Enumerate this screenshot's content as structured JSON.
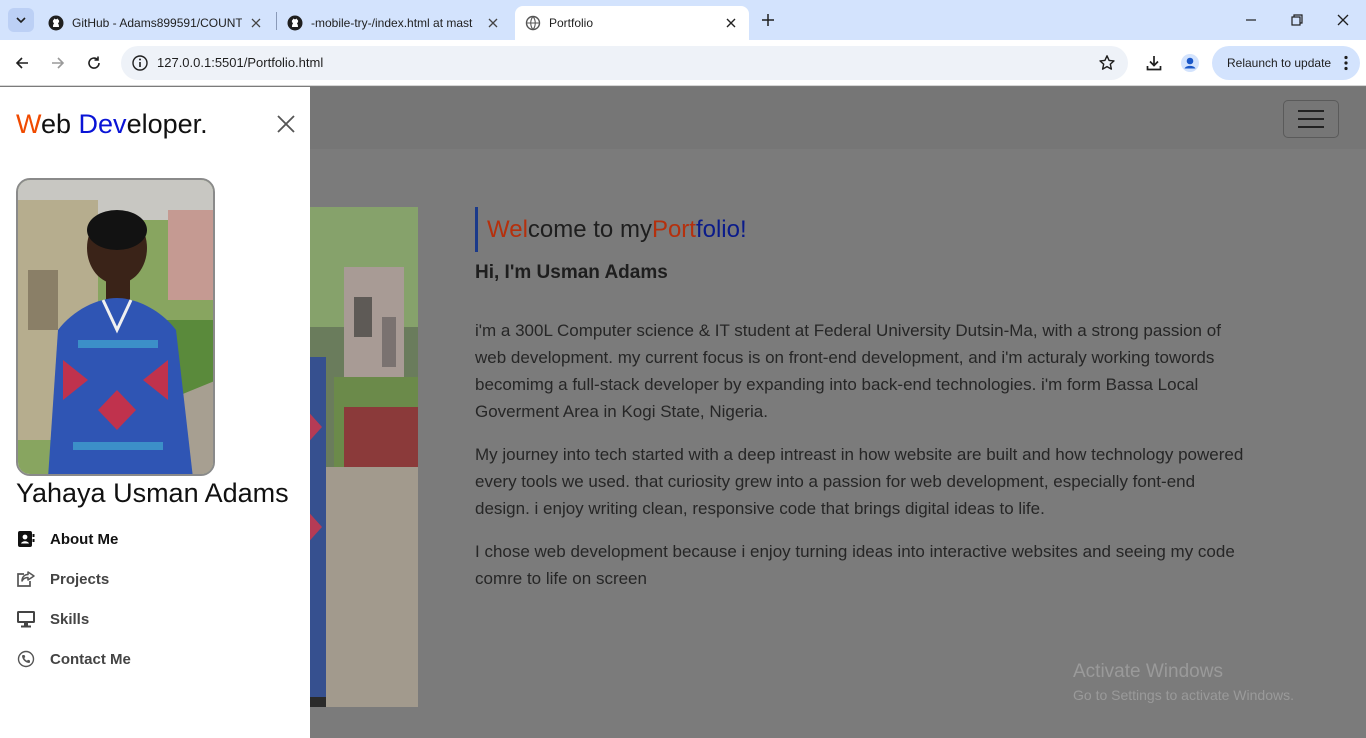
{
  "browser": {
    "tabs": [
      {
        "title": "GitHub - Adams899591/COUNT"
      },
      {
        "title": "-mobile-try-/index.html at mast"
      },
      {
        "title": "Portfolio"
      }
    ],
    "url": "127.0.0.1:5501/Portfolio.html",
    "relaunch_label": "Relaunch to update"
  },
  "sidebar": {
    "brand": {
      "p1": "W",
      "p2": "eb ",
      "p3": "Dev",
      "p4": "eloper."
    },
    "name": "Yahaya Usman Adams",
    "menu": [
      {
        "label": "About Me",
        "icon": "contact-card-icon"
      },
      {
        "label": "Projects",
        "icon": "share-icon"
      },
      {
        "label": "Skills",
        "icon": "desktop-icon"
      },
      {
        "label": "Contact Me",
        "icon": "phone-icon"
      }
    ]
  },
  "main": {
    "heading": {
      "p1": "Wel",
      "p2": "come to my ",
      "p3": "Port",
      "p4": "folio!"
    },
    "greeting": "Hi, I'm Usman Adams",
    "paragraphs": [
      "i'm a 300L Computer science & IT student at Federal University Dutsin-Ma, with a strong passion of web development. my current focus is on front-end development, and i'm acturaly working towords becomimg a full-stack developer by expanding into back-end technologies. i'm form Bassa Local Goverment Area in Kogi State, Nigeria.",
      "My journey into tech started with a deep intreast in how website are built and how technology powered every tools we used. that curiosity grew into a passion for web development, especially font-end design. i enjoy writing clean, responsive code that brings digital ideas to life.",
      "I chose web development because i enjoy turning ideas into interactive websites and seeing my code comre to life on screen"
    ]
  },
  "watermark": {
    "line1": "Activate Windows",
    "line2": "Go to Settings to activate Windows."
  },
  "colors": {
    "accent_orange": "#f04a00",
    "accent_blue": "#0a14d6"
  }
}
